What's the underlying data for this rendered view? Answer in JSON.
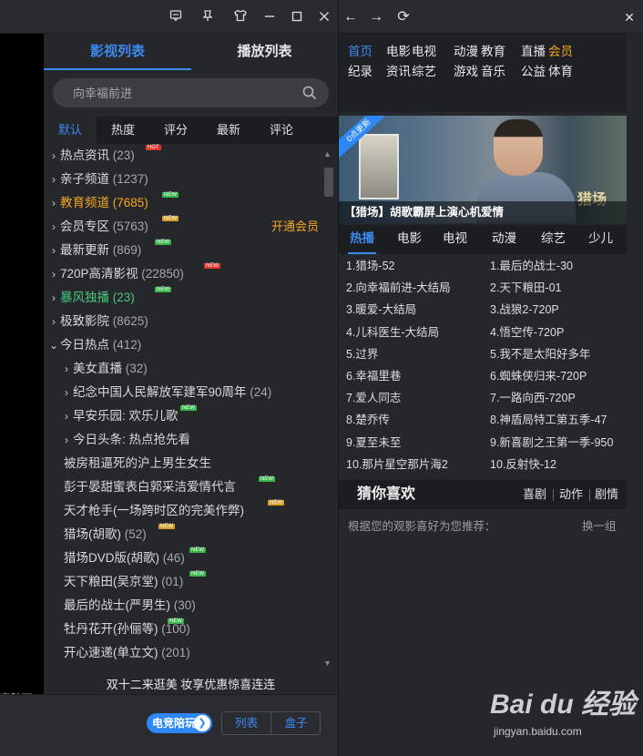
{
  "titlebar": {
    "icons": [
      "feedback-icon",
      "skin-icon",
      "shirt-icon",
      "minimize-icon",
      "maximize-icon",
      "close-icon"
    ]
  },
  "video": {
    "caption": "竞陪玩"
  },
  "panel_tabs": {
    "movies": "影视列表",
    "playlist": "播放列表"
  },
  "search": {
    "placeholder": "向幸福前进"
  },
  "sort_tabs": [
    "默认",
    "热度",
    "评分",
    "最新",
    "评论"
  ],
  "tree": [
    {
      "label": "热点资讯",
      "count": "(23)",
      "caret": "›",
      "level": 0,
      "color": "normal"
    },
    {
      "label": "亲子频道",
      "count": "(1237)",
      "caret": "›",
      "level": 0,
      "color": "normal"
    },
    {
      "label": "教育频道",
      "count": "(7685)",
      "caret": "›",
      "level": 0,
      "color": "orange"
    },
    {
      "label": "会员专区",
      "count": "(5763)",
      "caret": "›",
      "level": 0,
      "color": "normal"
    },
    {
      "label": "最新更新",
      "count": "(869)",
      "caret": "›",
      "level": 0,
      "color": "normal"
    },
    {
      "label": "720P高清影视",
      "count": "(22850)",
      "caret": "›",
      "level": 0,
      "color": "normal"
    },
    {
      "label": "暴风独播",
      "count": "(23)",
      "caret": "›",
      "level": 0,
      "color": "green"
    },
    {
      "label": "极致影院",
      "count": "(8625)",
      "caret": "›",
      "level": 0,
      "color": "normal"
    },
    {
      "label": "今日热点",
      "count": "(412)",
      "caret": "⌄",
      "level": 0,
      "color": "normal"
    },
    {
      "label": "美女直播",
      "count": "(32)",
      "caret": "›",
      "level": 1,
      "color": "normal"
    },
    {
      "label": "纪念中国人民解放军建军90周年",
      "count": "(24)",
      "caret": "›",
      "level": 1,
      "color": "normal"
    },
    {
      "label": "早安乐园: 欢乐儿歌",
      "count": "",
      "caret": "›",
      "level": 1,
      "color": "normal"
    },
    {
      "label": "今日头条: 热点抢先看",
      "count": "",
      "caret": "›",
      "level": 1,
      "color": "normal"
    },
    {
      "label": "被房租逼死的沪上男生女生",
      "count": "",
      "caret": "",
      "level": 2,
      "color": "normal"
    },
    {
      "label": "彭于晏甜蜜表白郭采洁爱情代言",
      "count": "",
      "caret": "",
      "level": 2,
      "color": "normal"
    },
    {
      "label": "天才枪手(一场跨时区的完美作弊)",
      "count": "",
      "caret": "",
      "level": 2,
      "color": "normal"
    },
    {
      "label": "猎场(胡歌)",
      "count": "(52)",
      "caret": "",
      "level": 2,
      "color": "normal"
    },
    {
      "label": "猎场DVD版(胡歌)",
      "count": "(46)",
      "caret": "",
      "level": 2,
      "color": "normal"
    },
    {
      "label": "天下粮田(吴京堂)",
      "count": "(01)",
      "caret": "",
      "level": 2,
      "color": "normal"
    },
    {
      "label": "最后的战士(严男生)",
      "count": "(30)",
      "caret": "",
      "level": 2,
      "color": "normal"
    },
    {
      "label": "牡丹花开(孙俪等)",
      "count": "(100)",
      "caret": "",
      "level": 2,
      "color": "normal"
    },
    {
      "label": "开心速递(单立文)",
      "count": "(201)",
      "caret": "",
      "level": 2,
      "color": "normal"
    }
  ],
  "vip_link": "开通会员",
  "badges": {
    "hot": "HOT",
    "new": "NEW"
  },
  "marquee": "双十二来逛美 妆享优惠惊喜连连",
  "bottom": {
    "esport_label": "电竞陪玩",
    "list_label": "列表",
    "box_label": "盒子"
  },
  "nav": {
    "back": "←",
    "forward": "→",
    "refresh": "⟳",
    "close": "✕"
  },
  "categories": [
    {
      "label": "首页",
      "style": "active"
    },
    {
      "label": "电影",
      "style": "normal"
    },
    {
      "label": "电视",
      "style": "normal"
    },
    {
      "label": "动漫",
      "style": "normal"
    },
    {
      "label": "教育",
      "style": "normal"
    },
    {
      "label": "直播",
      "style": "normal"
    },
    {
      "label": "会员",
      "style": "gold"
    },
    {
      "label": "纪录",
      "style": "normal"
    },
    {
      "label": "资讯",
      "style": "normal"
    },
    {
      "label": "综艺",
      "style": "normal"
    },
    {
      "label": "游戏",
      "style": "normal"
    },
    {
      "label": "音乐",
      "style": "normal"
    },
    {
      "label": "公益",
      "style": "normal"
    },
    {
      "label": "体育",
      "style": "normal"
    }
  ],
  "banner": {
    "tag": "0点更新",
    "logo": "猎场",
    "caption": "【猎场】胡歌霸屏上演心机爱情"
  },
  "hot_tabs": [
    "热播",
    "电影",
    "电视",
    "动漫",
    "综艺",
    "少儿"
  ],
  "rank_left": [
    "1.猎场-52",
    "2.向幸福前进-大结局",
    "3.暖爱-大结局",
    "4.儿科医生-大结局",
    "5.过界",
    "6.幸福里巷",
    "7.爱人同志",
    "8.楚乔传",
    "9.夏至未至",
    "10.那片星空那片海2"
  ],
  "rank_right": [
    "1.最后的战士-30",
    "2.天下粮田-01",
    "3.战狼2-720P",
    "4.悟空传-720P",
    "5.我不是太阳好多年",
    "6.蜘蛛侠归来-720P",
    "7.一路向西-720P",
    "8.神盾局特工第五季-47",
    "9.新喜剧之王第一季-950",
    "10.反射快-12"
  ],
  "guess": {
    "title": "猜你喜欢",
    "tags": [
      "喜剧",
      "动作",
      "剧情"
    ],
    "subtitle": "根据您的观影喜好为您推荐：",
    "refresh": "换一组"
  },
  "watermark": {
    "brand": "Bai du 经验",
    "site": "jingyan.baidu.com"
  }
}
